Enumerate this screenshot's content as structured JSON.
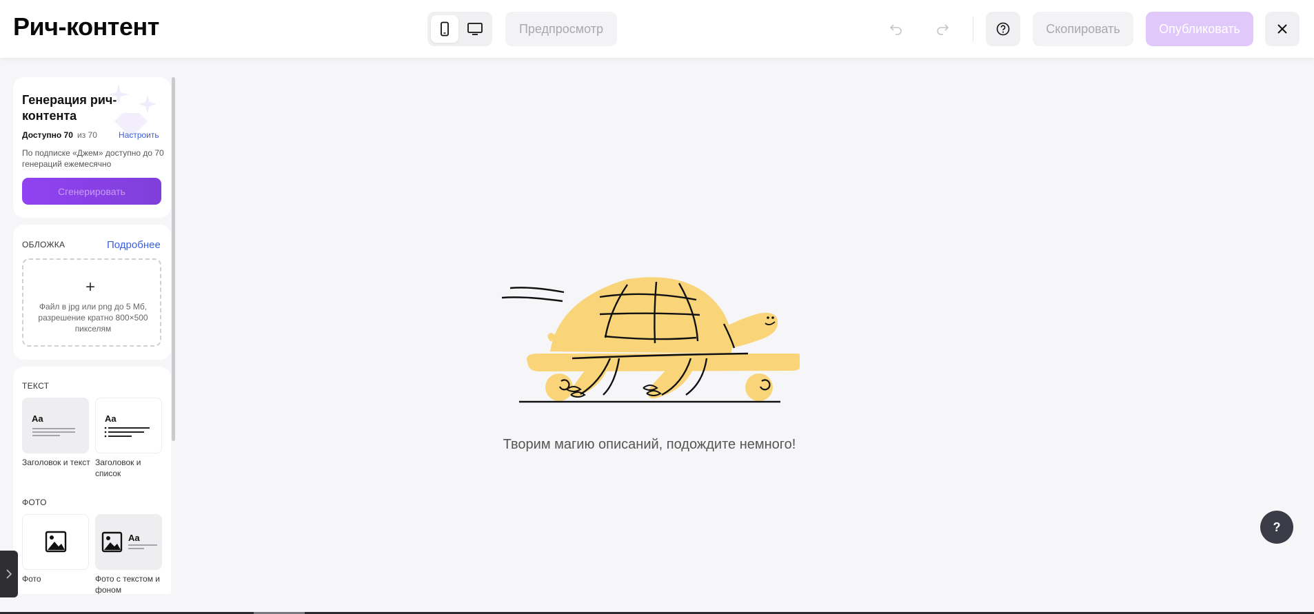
{
  "header": {
    "title": "Рич-контент",
    "preview_label": "Предпросмотр",
    "copy_label": "Скопировать",
    "publish_label": "Опубликовать",
    "device_mobile_icon": "mobile-icon",
    "device_desktop_icon": "desktop-icon"
  },
  "generation": {
    "title": "Генерация рич-контента",
    "available": "Доступно 70",
    "of_total": "из 70",
    "configure": "Настроить",
    "description": "По подписке «Джем» доступно до 70 генераций ежемесячно",
    "button": "Сгенерировать"
  },
  "cover": {
    "label": "ОБЛОЖКА",
    "more": "Подробнее",
    "plus": "+",
    "hint": "Файл в jpg или png до 5 Мб, разрешение кратно 800×500 пикселям"
  },
  "blocks": {
    "text_label": "ТЕКСТ",
    "photo_label": "ФОТО",
    "aa": "Aa",
    "items": [
      {
        "caption": "Заголовок и текст"
      },
      {
        "caption": "Заголовок и список"
      },
      {
        "caption": "Фото"
      },
      {
        "caption": "Фото с текстом и фоном"
      }
    ]
  },
  "main": {
    "loading_text": "Творим магию описаний, подождите немного!",
    "help_fab": "?"
  },
  "colors": {
    "accent": "#9142f2",
    "publish_disabled": "#e1c8fb",
    "link": "#3a5ee0",
    "turtle": "#f9d478"
  }
}
